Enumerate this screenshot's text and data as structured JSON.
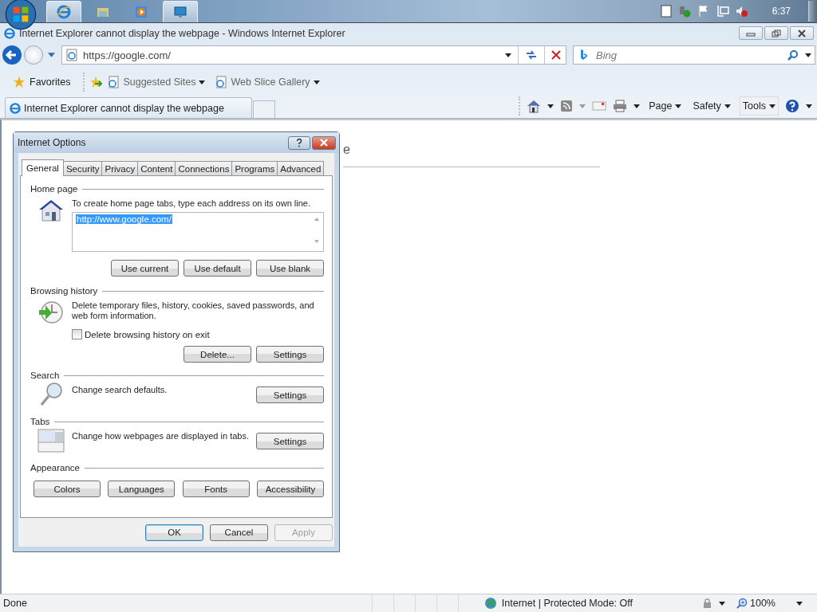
{
  "taskbar": {
    "buttons": [
      {
        "kind": "ie",
        "active": true
      },
      {
        "kind": "folder",
        "active": false
      },
      {
        "kind": "media",
        "active": false
      },
      {
        "kind": "remote",
        "active": true
      }
    ],
    "clock": "6:37"
  },
  "window": {
    "title": "Internet Explorer cannot display the webpage - Windows Internet Explorer"
  },
  "address_bar": {
    "url": "https://google.com/"
  },
  "search": {
    "placeholder": "Bing"
  },
  "favorites_bar": {
    "favorites": "Favorites",
    "links": [
      "Suggested Sites",
      "Web Slice Gallery"
    ]
  },
  "tabs": [
    {
      "label": "Internet Explorer cannot display the webpage",
      "selected": true
    }
  ],
  "command_bar": [
    "Page",
    "Safety",
    "Tools"
  ],
  "page": {
    "heading": "e"
  },
  "dialog": {
    "title": "Internet Options",
    "tabs": [
      {
        "label": "General",
        "selected": true
      },
      {
        "label": "Security",
        "selected": false
      },
      {
        "label": "Privacy",
        "selected": false
      },
      {
        "label": "Content",
        "selected": false
      },
      {
        "label": "Connections",
        "selected": false
      },
      {
        "label": "Programs",
        "selected": false
      },
      {
        "label": "Advanced",
        "selected": false
      }
    ],
    "sections": [
      {
        "kind": "home",
        "label": "Home page",
        "text": "To create home page tabs, type each address on its own line.",
        "value": "http://www.google.com/",
        "buttons": [
          "Use current",
          "Use default",
          "Use blank"
        ]
      },
      {
        "kind": "history",
        "label": "Browsing history",
        "text": "Delete temporary files, history, cookies, saved passwords, and web form information.",
        "checkbox": {
          "label": "Delete browsing history on exit",
          "checked": false
        },
        "buttons": [
          "Delete...",
          "Settings"
        ]
      },
      {
        "kind": "search",
        "label": "Search",
        "text": "Change search defaults.",
        "buttons": [
          "Settings"
        ]
      },
      {
        "kind": "tabs",
        "label": "Tabs",
        "text": "Change how webpages are displayed in tabs.",
        "buttons": [
          "Settings"
        ]
      },
      {
        "kind": "appearance",
        "label": "Appearance",
        "buttons": [
          "Colors",
          "Languages",
          "Fonts",
          "Accessibility"
        ]
      }
    ],
    "footer": [
      {
        "label": "OK",
        "default": true,
        "disabled": false
      },
      {
        "label": "Cancel",
        "default": false,
        "disabled": false
      },
      {
        "label": "Apply",
        "default": false,
        "disabled": true
      }
    ]
  },
  "status_bar": {
    "status": "Done",
    "zone": "Internet | Protected Mode: Off",
    "zoom": "100%"
  }
}
